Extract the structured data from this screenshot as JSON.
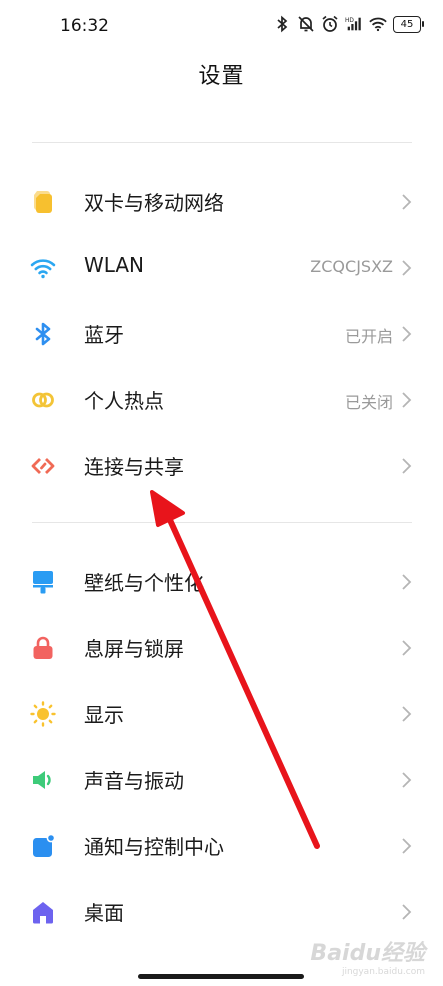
{
  "status_bar": {
    "time": "16:32",
    "battery": "45",
    "icons": [
      "bluetooth-icon",
      "mute-bell-icon",
      "alarm-icon",
      "hd-signal-icon",
      "wifi-icon",
      "battery-icon"
    ]
  },
  "header": {
    "title": "设置"
  },
  "groups": [
    {
      "items": [
        {
          "label": "双卡与移动网络",
          "value": "",
          "icon": "sim-card-icon",
          "color": "#f7c02f"
        },
        {
          "label": "WLAN",
          "value": "ZCQCJSXZ",
          "icon": "wifi-icon",
          "color": "#2ba7f1"
        },
        {
          "label": "蓝牙",
          "value": "已开启",
          "icon": "bluetooth-icon",
          "color": "#2e8ff0"
        },
        {
          "label": "个人热点",
          "value": "已关闭",
          "icon": "hotspot-icon",
          "color": "#f3c437"
        },
        {
          "label": "连接与共享",
          "value": "",
          "icon": "connection-share-icon",
          "color": "#f06a55"
        }
      ]
    },
    {
      "items": [
        {
          "label": "壁纸与个性化",
          "value": "",
          "icon": "wallpaper-icon",
          "color": "#2a9cf3"
        },
        {
          "label": "息屏与锁屏",
          "value": "",
          "icon": "lock-icon",
          "color": "#f26360"
        },
        {
          "label": "显示",
          "value": "",
          "icon": "sun-icon",
          "color": "#f9c22e"
        },
        {
          "label": "声音与振动",
          "value": "",
          "icon": "speaker-icon",
          "color": "#3dcb79"
        },
        {
          "label": "通知与控制中心",
          "value": "",
          "icon": "notification-icon",
          "color": "#2b8ff0"
        },
        {
          "label": "桌面",
          "value": "",
          "icon": "home-icon",
          "color": "#6d63ef"
        }
      ]
    }
  ],
  "annotation": {
    "color": "#e8141b"
  },
  "watermark": {
    "main": "Baidu经验",
    "sub": "jingyan.baidu.com"
  }
}
